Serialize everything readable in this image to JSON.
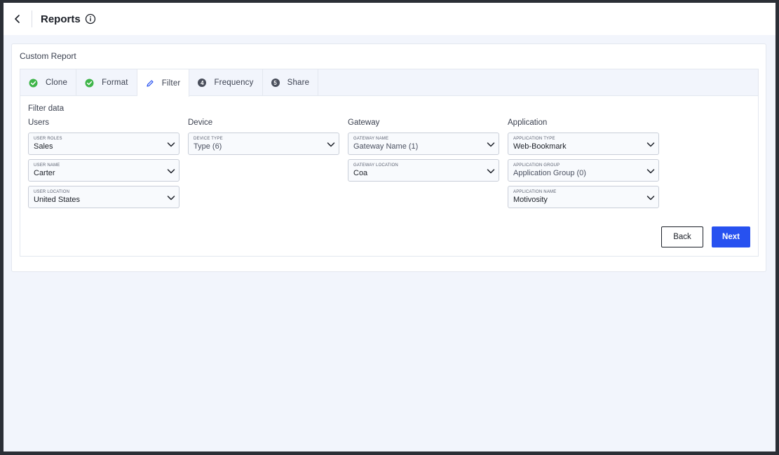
{
  "header": {
    "title": "Reports"
  },
  "card": {
    "title": "Custom Report"
  },
  "tabs": [
    {
      "label": "Clone",
      "status": "done"
    },
    {
      "label": "Format",
      "status": "done"
    },
    {
      "label": "Filter",
      "status": "active"
    },
    {
      "label": "Frequency",
      "status": "pending",
      "number": "4"
    },
    {
      "label": "Share",
      "status": "pending",
      "number": "5"
    }
  ],
  "filter": {
    "heading": "Filter data",
    "columns": [
      {
        "label": "Users",
        "fields": [
          {
            "label": "USER ROLES",
            "value": "Sales"
          },
          {
            "label": "USER NAME",
            "value": "Carter"
          },
          {
            "label": "USER LOCATION",
            "value": "United States"
          }
        ]
      },
      {
        "label": "Device",
        "fields": [
          {
            "label": "DEVICE TYPE",
            "value": "Type (6)"
          }
        ]
      },
      {
        "label": "Gateway",
        "fields": [
          {
            "label": "GATEWAY NAME",
            "value": "Gateway Name (1)"
          },
          {
            "label": "GATEWAY LOCATION",
            "value": "Coa"
          }
        ]
      },
      {
        "label": "Application",
        "fields": [
          {
            "label": "APPLICATION TYPE",
            "value": "Web-Bookmark"
          },
          {
            "label": "APPLICATION GROUP",
            "value": "Application Group (0)"
          },
          {
            "label": "APPLICATION NAME",
            "value": "Motivosity"
          }
        ]
      }
    ]
  },
  "actions": {
    "back_label": "Back",
    "next_label": "Next"
  },
  "colors": {
    "accent": "#2751f0",
    "success": "#3fb54a",
    "edit": "#2751f0"
  },
  "icons": {
    "back": "chevron-left-icon",
    "info": "info-icon",
    "done": "check-circle-icon",
    "edit": "pencil-icon",
    "dropdown": "chevron-down-icon"
  }
}
